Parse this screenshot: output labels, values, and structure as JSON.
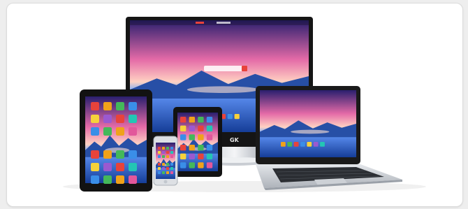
{
  "image": {
    "subject": "devices-collage",
    "devices": [
      "monitor",
      "laptop",
      "tablet-large",
      "tablet-small",
      "smartphone"
    ],
    "monitor_brand": "GK",
    "colors": {
      "sky_top": "#2a1f6e",
      "sky_mid": "#e46aa7",
      "sky_glow": "#ffd1c2",
      "mountain": "#1f4fa8",
      "water": "#2b6fd6",
      "bezel": "#151515",
      "silver": "#c9cdd3"
    },
    "icons": [
      "red",
      "orange",
      "yellow",
      "green",
      "blue",
      "purple"
    ]
  }
}
